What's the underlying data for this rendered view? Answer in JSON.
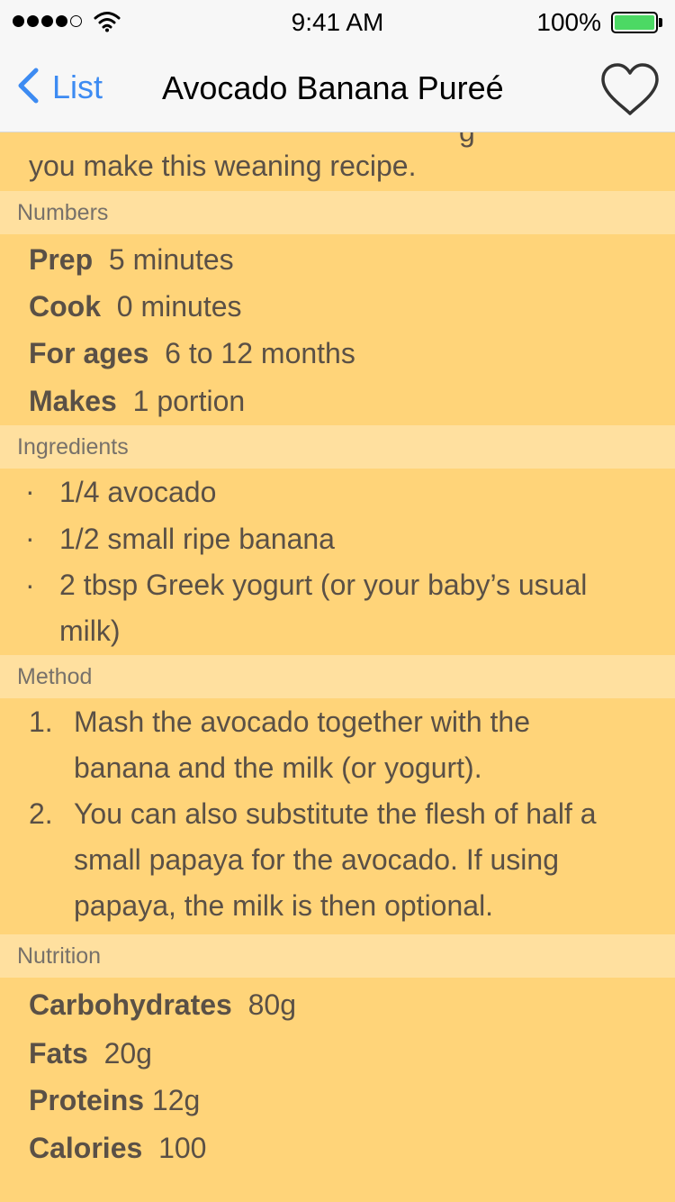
{
  "status_bar": {
    "signal_icon": "cellular-signal-icon",
    "wifi_icon": "wifi-icon",
    "time": "9:41 AM",
    "battery_percent": "100%",
    "battery_icon": "battery-icon",
    "battery_level": 1.0,
    "battery_color": "#4CD964"
  },
  "nav": {
    "back_icon": "chevron-left-icon",
    "back_label": "List",
    "title": "Avocado Banana Pureé",
    "favorite_icon": "heart-outline-icon",
    "accent_color": "#3D8BF2"
  },
  "intro": {
    "partial_line": "g",
    "text": "you make this weaning recipe."
  },
  "sections": {
    "numbers": {
      "header": "Numbers",
      "rows": [
        {
          "label": "Prep",
          "value": "5 minutes"
        },
        {
          "label": "Cook",
          "value": "0 minutes"
        },
        {
          "label": "For ages",
          "value": "6 to 12 months"
        },
        {
          "label": "Makes",
          "value": "1 portion"
        }
      ]
    },
    "ingredients": {
      "header": "Ingredients",
      "items": [
        {
          "lines": [
            "1/4 avocado"
          ]
        },
        {
          "lines": [
            "1/2 small ripe banana"
          ]
        },
        {
          "lines": [
            "2 tbsp Greek yogurt (or your baby’s usual",
            "milk)"
          ]
        }
      ]
    },
    "method": {
      "header": "Method",
      "steps": [
        {
          "number": "1.",
          "lines": [
            "Mash the avocado together with the",
            "banana and the milk (or yogurt)."
          ]
        },
        {
          "number": "2.",
          "lines": [
            "You can also substitute the flesh of half a",
            "small papaya for the avocado. If using",
            "papaya, the milk is then optional."
          ]
        }
      ]
    },
    "nutrition": {
      "header": "Nutrition",
      "rows": [
        {
          "label": "Carbohydrates",
          "value": "80g"
        },
        {
          "label": "Fats",
          "value": "20g"
        },
        {
          "label": "Proteins",
          "value": "12g"
        },
        {
          "label": "Calories",
          "value": "100"
        }
      ]
    }
  },
  "colors": {
    "background": "#FFD479",
    "section_header": "#FFE09F",
    "text": "#5A5046"
  }
}
